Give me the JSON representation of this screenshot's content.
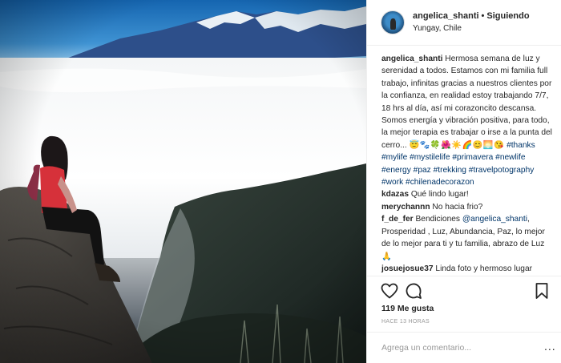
{
  "post": {
    "photo_alt": "",
    "header": {
      "username": "angelica_shanti",
      "separator": "•",
      "follow_label": "Siguiendo",
      "location": "Yungay, Chile"
    },
    "caption": {
      "username": "angelica_shanti",
      "text": "Hermosa semana de luz y serenidad a todos. Estamos con mi familia full trabajo, infinitas gracias a nuestros clientes por la confianza, en realidad estoy trabajando 7/7, 18 hrs al día, así mi corazoncito descansa. Somos energía y vibración positiva, para todo, la mejor terapia es trabajar o irse a la punta del cerro...",
      "emojis": "😇🐾🍀🌺☀️🌈😊🌅😘",
      "hashtags": [
        "#thanks",
        "#mylife",
        "#mystilelife",
        "#primavera",
        "#newlife",
        "#energy",
        "#paz",
        "#trekking",
        "#travelpotography",
        "#work",
        "#chilenadecorazon"
      ]
    },
    "comments": [
      {
        "username": "kdazas",
        "text": "Qué lindo lugar!"
      },
      {
        "username": "merychannn",
        "text": "No hacia frio?"
      },
      {
        "username": "f_de_fer",
        "prefix": "Bendiciones",
        "mention": "@angelica_shanti",
        "text": ", Prosperidad , Luz, Abundancia, Paz, lo mejor de lo mejor para ti y tu familia, abrazo de Luz 🙏"
      },
      {
        "username": "josuejosue37",
        "text": "Linda foto y hermoso lugar"
      }
    ],
    "actions": {
      "like_icon": "heart-icon",
      "comment_icon": "speech-bubble-icon",
      "save_icon": "bookmark-icon"
    },
    "likes": "119 Me gusta",
    "time_ago": "HACE 13 HORAS",
    "comment_input": {
      "placeholder": "Agrega un comentario...",
      "value": ""
    },
    "more_label": "..."
  },
  "colors": {
    "link": "#003569",
    "border": "#efefef",
    "muted": "#999999",
    "text": "#262626"
  }
}
